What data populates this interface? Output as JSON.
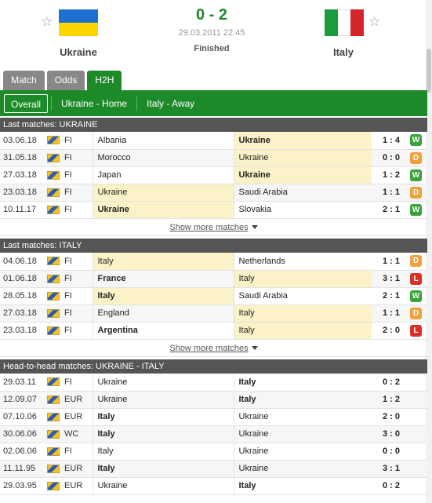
{
  "match": {
    "home": "Ukraine",
    "away": "Italy",
    "score": "0 - 2",
    "datetime": "29.03.2011 22:45",
    "status": "Finished",
    "home_flag_colors": [
      "#1f6fd1",
      "#ffd500"
    ],
    "away_flag_colors": [
      "#1a9b3c",
      "#ffffff",
      "#d6242b"
    ]
  },
  "tabs": [
    {
      "label": "Match",
      "active": false
    },
    {
      "label": "Odds",
      "active": false
    },
    {
      "label": "H2H",
      "active": true
    }
  ],
  "subtabs": [
    {
      "label": "Overall",
      "active": true
    },
    {
      "label": "Ukraine - Home",
      "active": false
    },
    {
      "label": "Italy - Away",
      "active": false
    }
  ],
  "sections": [
    {
      "title": "Last matches: UKRAINE",
      "show_more": "Show more matches",
      "rows": [
        {
          "date": "03.06.18",
          "comp": "FI",
          "home": "Albania",
          "away": "Ukraine",
          "score": "1 : 4",
          "result": "W",
          "hl": "away",
          "bold": "away"
        },
        {
          "date": "31.05.18",
          "comp": "FI",
          "home": "Morocco",
          "away": "Ukraine",
          "score": "0 : 0",
          "result": "D",
          "hl": "away",
          "bold": ""
        },
        {
          "date": "27.03.18",
          "comp": "FI",
          "home": "Japan",
          "away": "Ukraine",
          "score": "1 : 2",
          "result": "W",
          "hl": "away",
          "bold": "away"
        },
        {
          "date": "23.03.18",
          "comp": "FI",
          "home": "Ukraine",
          "away": "Saudi Arabia",
          "score": "1 : 1",
          "result": "D",
          "hl": "home",
          "bold": ""
        },
        {
          "date": "10.11.17",
          "comp": "FI",
          "home": "Ukraine",
          "away": "Slovakia",
          "score": "2 : 1",
          "result": "W",
          "hl": "home",
          "bold": "home"
        }
      ]
    },
    {
      "title": "Last matches: ITALY",
      "show_more": "Show more matches",
      "rows": [
        {
          "date": "04.06.18",
          "comp": "FI",
          "home": "Italy",
          "away": "Netherlands",
          "score": "1 : 1",
          "result": "D",
          "hl": "home",
          "bold": ""
        },
        {
          "date": "01.06.18",
          "comp": "FI",
          "home": "France",
          "away": "Italy",
          "score": "3 : 1",
          "result": "L",
          "hl": "away",
          "bold": "home"
        },
        {
          "date": "28.05.18",
          "comp": "FI",
          "home": "Italy",
          "away": "Saudi Arabia",
          "score": "2 : 1",
          "result": "W",
          "hl": "home",
          "bold": "home"
        },
        {
          "date": "27.03.18",
          "comp": "FI",
          "home": "England",
          "away": "Italy",
          "score": "1 : 1",
          "result": "D",
          "hl": "away",
          "bold": ""
        },
        {
          "date": "23.03.18",
          "comp": "FI",
          "home": "Argentina",
          "away": "Italy",
          "score": "2 : 0",
          "result": "L",
          "hl": "away",
          "bold": "home"
        }
      ]
    },
    {
      "title": "Head-to-head matches: UKRAINE - ITALY",
      "show_more": "",
      "rows": [
        {
          "date": "29.03.11",
          "comp": "FI",
          "home": "Ukraine",
          "away": "Italy",
          "score": "0 : 2",
          "result": "",
          "hl": "",
          "bold": "away"
        },
        {
          "date": "12.09.07",
          "comp": "EUR",
          "home": "Ukraine",
          "away": "Italy",
          "score": "1 : 2",
          "result": "",
          "hl": "",
          "bold": "away"
        },
        {
          "date": "07.10.06",
          "comp": "EUR",
          "home": "Italy",
          "away": "Ukraine",
          "score": "2 : 0",
          "result": "",
          "hl": "",
          "bold": "home"
        },
        {
          "date": "30.06.06",
          "comp": "WC",
          "home": "Italy",
          "away": "Ukraine",
          "score": "3 : 0",
          "result": "",
          "hl": "",
          "bold": "home"
        },
        {
          "date": "02.06.06",
          "comp": "FI",
          "home": "Italy",
          "away": "Ukraine",
          "score": "0 : 0",
          "result": "",
          "hl": "",
          "bold": ""
        },
        {
          "date": "11.11.95",
          "comp": "EUR",
          "home": "Italy",
          "away": "Ukraine",
          "score": "3 : 1",
          "result": "",
          "hl": "",
          "bold": "home"
        },
        {
          "date": "29.03.95",
          "comp": "EUR",
          "home": "Ukraine",
          "away": "Italy",
          "score": "0 : 2",
          "result": "",
          "hl": "",
          "bold": "away"
        }
      ]
    }
  ]
}
